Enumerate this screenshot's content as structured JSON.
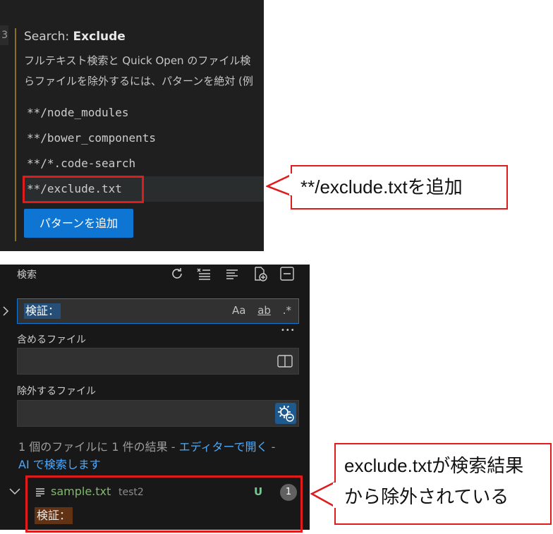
{
  "settings": {
    "gutter_text": "3",
    "title_prefix": "Search: ",
    "title_bold": "Exclude",
    "description_line1": "フルテキスト検索と Quick Open のファイル検",
    "description_line2": "らファイルを除外するには、パターンを絶対 (例",
    "patterns": [
      "**/node_modules",
      "**/bower_components",
      "**/*.code-search",
      "**/exclude.txt"
    ],
    "add_pattern_button": "パターンを追加"
  },
  "callouts": {
    "added": "**/exclude.txtを追加",
    "excluded_line1": "exclude.txtが検索結果",
    "excluded_line2": "から除外されている"
  },
  "search": {
    "header": "検索",
    "toolbar_icons": [
      "refresh-icon",
      "clear-results-icon",
      "collapse-all-icon",
      "new-search-editor-icon",
      "view-as-tree-icon"
    ],
    "query_value": "検証：",
    "query_toggles": {
      "match_case": "Aa",
      "whole_word": "ab",
      "regex": ".*"
    },
    "more_options": "•••",
    "include_label": "含めるファイル",
    "include_value": "",
    "exclude_label": "除外するファイル",
    "exclude_value": "",
    "summary_text": "1 個のファイルに 1 件の結果 - ",
    "summary_link1": "エディターで開く",
    "summary_sep": " -",
    "summary_link2": "AI で検索します",
    "result_file": "sample.txt",
    "result_dir": "test2",
    "result_status": "U",
    "result_count": "1",
    "match_text": "検証："
  },
  "colors": {
    "accent": "#0e76d2",
    "callout_red": "#e01b1b",
    "link": "#4daafc",
    "untracked_green": "#73c991"
  }
}
